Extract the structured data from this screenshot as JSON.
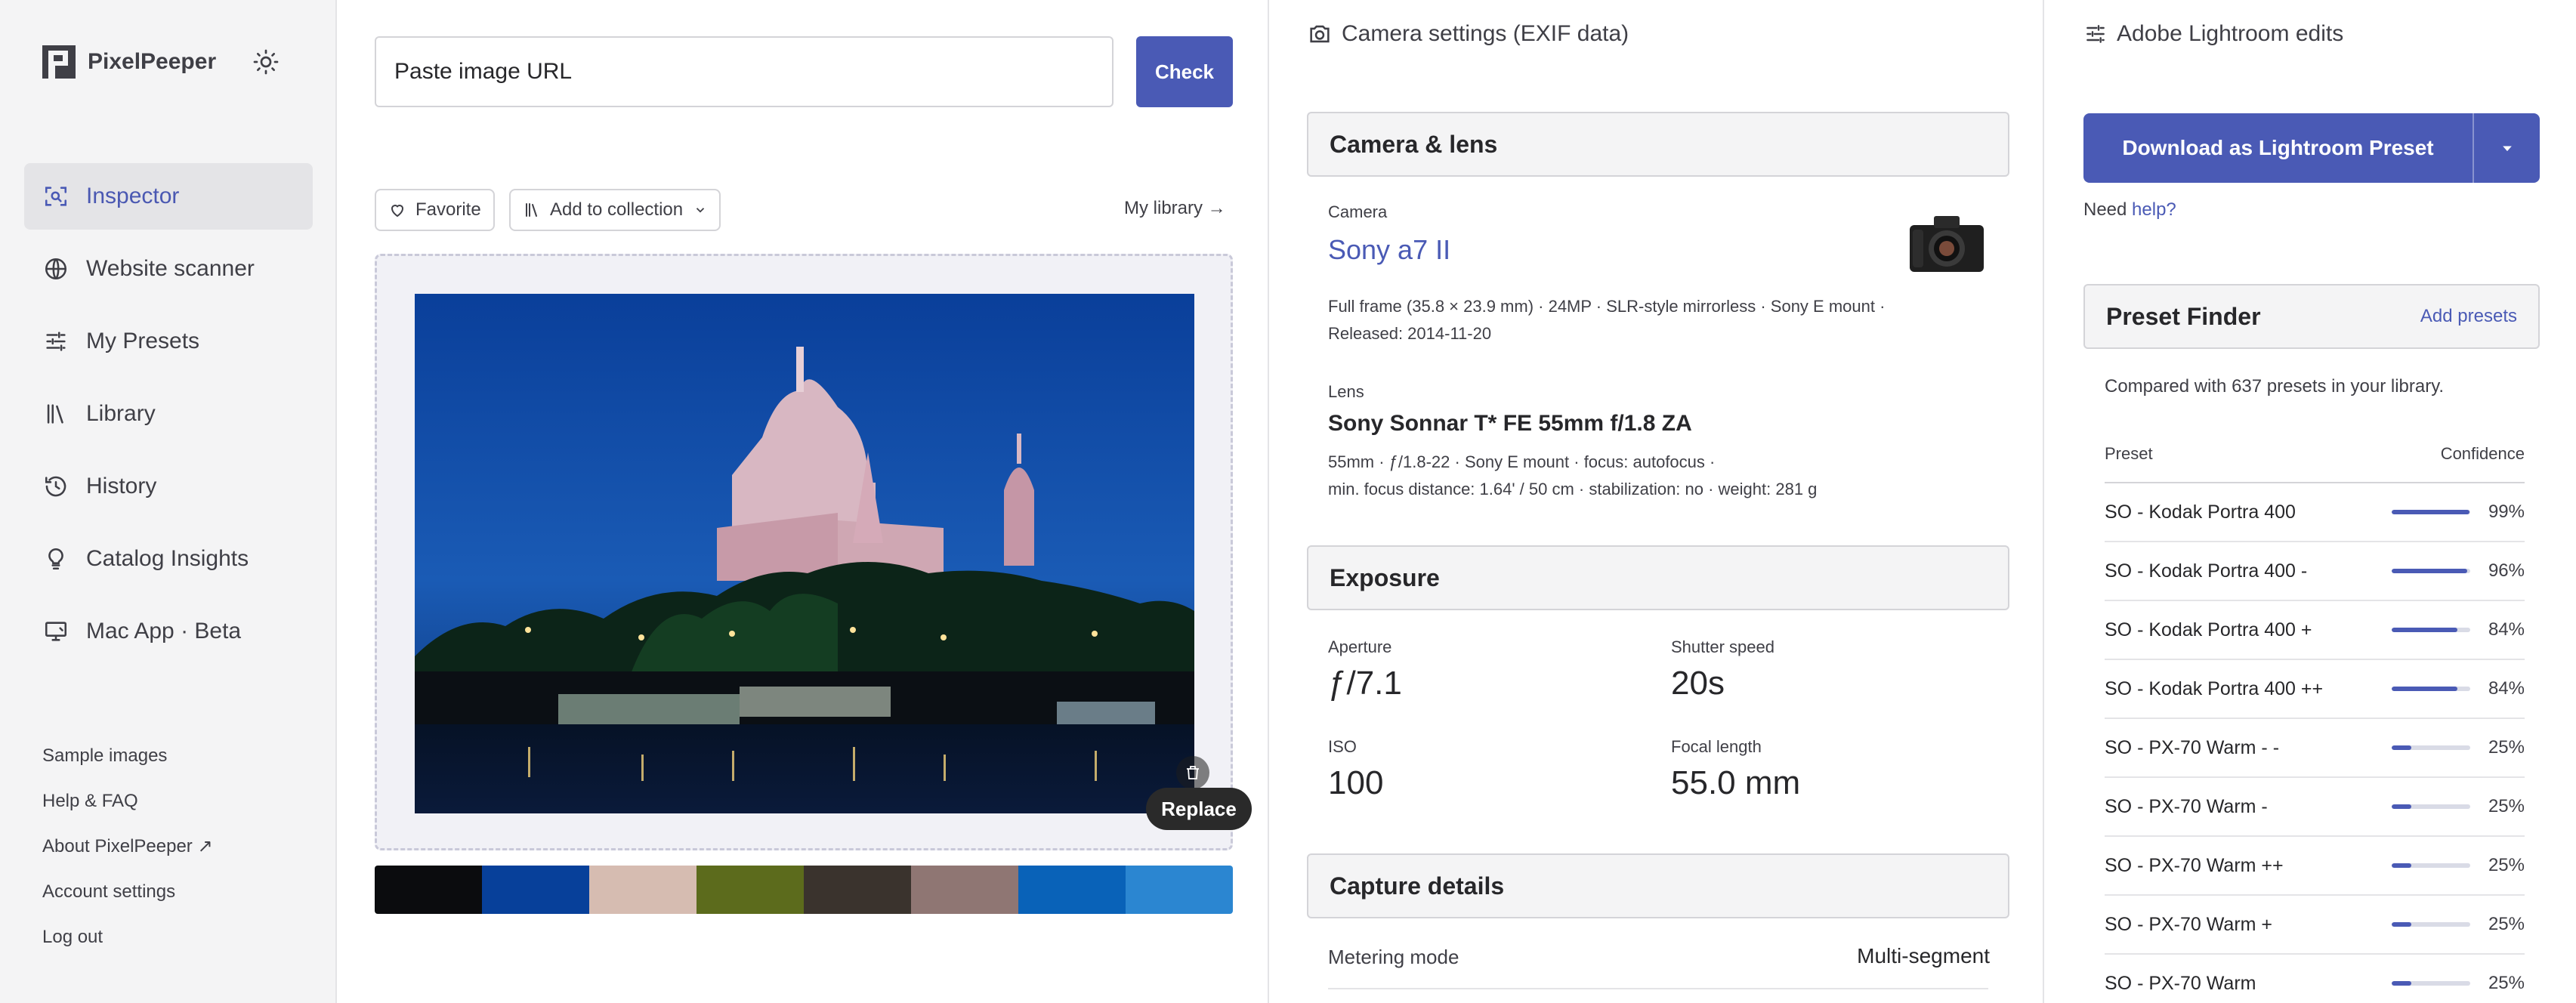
{
  "brand": {
    "name": "PixelPeeper"
  },
  "sidebar": {
    "nav": [
      {
        "label": "Inspector",
        "icon": "inspector-icon",
        "active": true
      },
      {
        "label": "Website scanner",
        "icon": "globe-icon"
      },
      {
        "label": "My Presets",
        "icon": "sliders-icon"
      },
      {
        "label": "Library",
        "icon": "library-icon"
      },
      {
        "label": "History",
        "icon": "history-icon"
      },
      {
        "label": "Catalog Insights",
        "icon": "lightbulb-icon"
      },
      {
        "label": "Mac App · Beta",
        "icon": "monitor-icon"
      }
    ],
    "bottom_links": [
      "Sample images",
      "Help & FAQ",
      "About PixelPeeper ↗",
      "Account settings",
      "Log out"
    ]
  },
  "inspector": {
    "url_placeholder": "Paste image URL",
    "check_label": "Check",
    "favorite_label": "Favorite",
    "add_collection_label": "Add to collection",
    "my_library_label": "My library →",
    "replace_label": "Replace",
    "palette": [
      "#0b0c0e",
      "#07409a",
      "#d6bcb1",
      "#5c6b1c",
      "#3a332d",
      "#8f7673",
      "#0962b8",
      "#2b86d1"
    ]
  },
  "exif": {
    "header": "Camera settings (EXIF data)",
    "camera_lens": {
      "title": "Camera & lens",
      "camera_label": "Camera",
      "camera_name": "Sony a7 II",
      "camera_meta_1": "Full frame (35.8 × 23.9 mm)  ·  24MP  ·  SLR-style mirrorless  ·  Sony E mount  ·",
      "camera_meta_2": "Released: 2014-11-20",
      "lens_label": "Lens",
      "lens_name": "Sony Sonnar T* FE 55mm f/1.8 ZA",
      "lens_meta_1": "55mm  ·  ƒ/1.8-22  ·  Sony E mount  ·  focus: autofocus  ·",
      "lens_meta_2": "min. focus distance: 1.64' / 50 cm  ·  stabilization: no  ·  weight: 281 g"
    },
    "exposure": {
      "title": "Exposure",
      "aperture_label": "Aperture",
      "aperture": "ƒ/7.1",
      "shutter_label": "Shutter speed",
      "shutter": "20s",
      "iso_label": "ISO",
      "iso": "100",
      "focal_label": "Focal length",
      "focal": "55.0 mm"
    },
    "capture": {
      "title": "Capture details",
      "metering_label": "Metering mode",
      "metering_value": "Multi-segment"
    }
  },
  "lightroom": {
    "header": "Adobe Lightroom edits",
    "download_label": "Download as Lightroom Preset",
    "need_help_prefix": "Need ",
    "need_help_link": "help?",
    "preset_finder": {
      "title": "Preset Finder",
      "add_label": "Add presets",
      "compared": "Compared with 637 presets in your library.",
      "col_preset": "Preset",
      "col_confidence": "Confidence",
      "rows": [
        {
          "name": "SO - Kodak Portra 400",
          "confidence": 99,
          "label": "99%"
        },
        {
          "name": "SO - Kodak Portra 400 -",
          "confidence": 96,
          "label": "96%"
        },
        {
          "name": "SO - Kodak Portra 400 +",
          "confidence": 84,
          "label": "84%"
        },
        {
          "name": "SO - Kodak Portra 400 ++",
          "confidence": 84,
          "label": "84%"
        },
        {
          "name": "SO - PX-70 Warm - -",
          "confidence": 25,
          "label": "25%"
        },
        {
          "name": "SO - PX-70 Warm -",
          "confidence": 25,
          "label": "25%"
        },
        {
          "name": "SO - PX-70 Warm ++",
          "confidence": 25,
          "label": "25%"
        },
        {
          "name": "SO - PX-70 Warm +",
          "confidence": 25,
          "label": "25%"
        },
        {
          "name": "SO - PX-70 Warm",
          "confidence": 25,
          "label": "25%"
        }
      ]
    }
  },
  "colors": {
    "accent": "#4a5ab5",
    "sidebar_bg": "#f4f4f5"
  }
}
